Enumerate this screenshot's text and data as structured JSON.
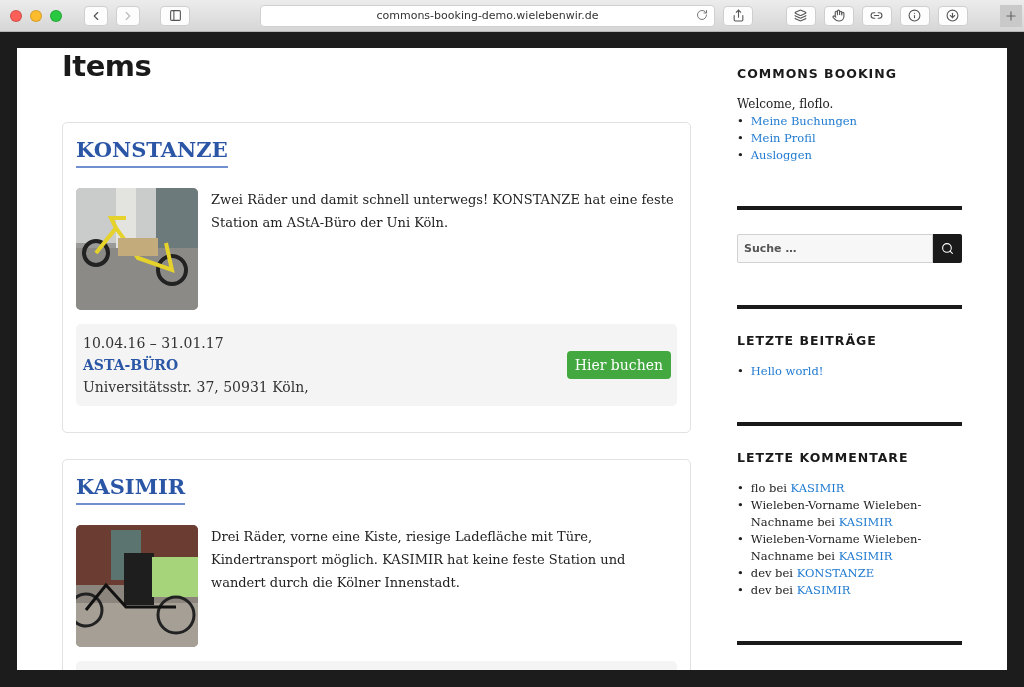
{
  "browser": {
    "url": "commons-booking-demo.wielebenwir.de"
  },
  "page_title": "Items",
  "items": [
    {
      "name": "KONSTANZE",
      "description": "Zwei Räder und damit schnell unterwegs! KONSTANZE hat eine feste Station am AStA-Büro der Uni Köln.",
      "booking": {
        "dates": "10.04.16 – 31.01.17",
        "location": "ASTA-BÜRO",
        "address": "Universitätsstr. 37, 50931 Köln,",
        "button": "Hier buchen"
      }
    },
    {
      "name": "KASIMIR",
      "description": "Drei Räder, vorne eine Kiste, riesige Ladefläche mit Türe, Kindertransport möglich. KASIMIR hat keine feste Station und wandert durch die Kölner Innenstadt."
    }
  ],
  "sidebar": {
    "bullet": "•",
    "commons_booking": {
      "title": "COMMONS BOOKING",
      "welcome": "Welcome, floflo.",
      "links": [
        "Meine Buchungen",
        "Mein Profil",
        "Ausloggen"
      ]
    },
    "search": {
      "placeholder": "Suche …"
    },
    "recent_posts": {
      "title": "LETZTE BEITRÄGE",
      "links": [
        "Hello world!"
      ]
    },
    "recent_comments": {
      "title": "LETZTE KOMMENTARE",
      "items": [
        {
          "author": "flo bei",
          "post": "KASIMIR"
        },
        {
          "author": "Wieleben-Vorname Wieleben-Nachname bei",
          "post": "KASIMIR"
        },
        {
          "author": "Wieleben-Vorname Wieleben-Nachname bei",
          "post": "KASIMIR"
        },
        {
          "author": "dev bei",
          "post": "KONSTANZE"
        },
        {
          "author": "dev bei",
          "post": "KASIMIR"
        }
      ]
    }
  }
}
